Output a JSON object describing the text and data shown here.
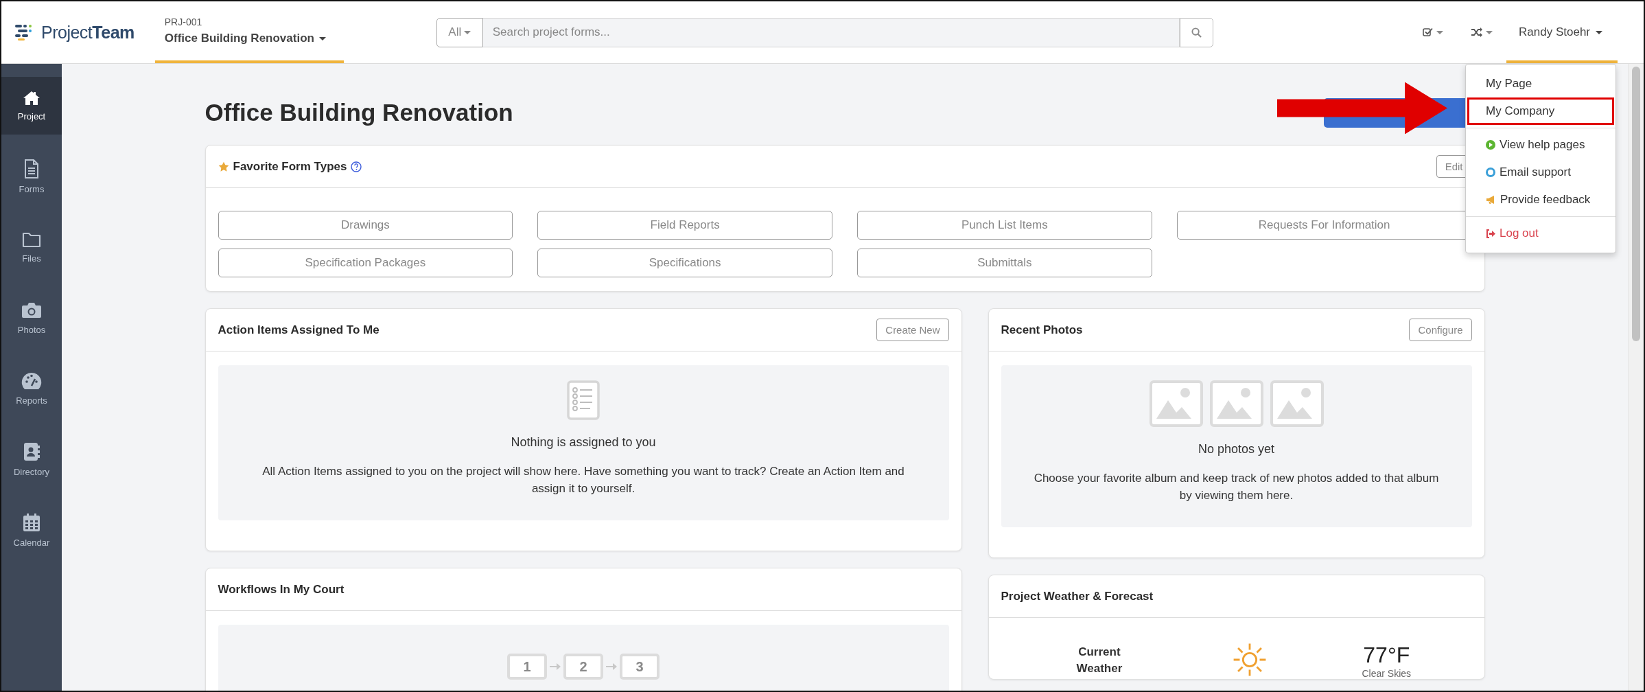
{
  "logo": {
    "light": "Project",
    "bold": "Team"
  },
  "project": {
    "code": "PRJ-001",
    "name": "Office Building Renovation"
  },
  "search": {
    "scope": "All",
    "placeholder": "Search project forms..."
  },
  "user": {
    "name": "Randy Stoehr"
  },
  "user_menu": {
    "groups": [
      {
        "items": [
          {
            "label": "My Page",
            "kind": "plain",
            "highlighted": false
          },
          {
            "label": "My Company",
            "kind": "plain",
            "highlighted": true
          }
        ]
      },
      {
        "items": [
          {
            "label": "View help pages",
            "kind": "help",
            "highlighted": false
          },
          {
            "label": "Email support",
            "kind": "email",
            "highlighted": false
          },
          {
            "label": "Provide feedback",
            "kind": "feedback",
            "highlighted": false
          }
        ]
      },
      {
        "items": [
          {
            "label": "Log out",
            "kind": "logout",
            "highlighted": false
          }
        ]
      }
    ]
  },
  "sidebar": {
    "items": [
      {
        "label": "Project",
        "kind": "home",
        "selected": true
      },
      {
        "label": "Forms",
        "kind": "forms",
        "selected": false
      },
      {
        "label": "Files",
        "kind": "files",
        "selected": false
      },
      {
        "label": "Photos",
        "kind": "photos",
        "selected": false
      },
      {
        "label": "Reports",
        "kind": "reports",
        "selected": false
      },
      {
        "label": "Directory",
        "kind": "directory",
        "selected": false
      },
      {
        "label": "Calendar",
        "kind": "calendar",
        "selected": false
      }
    ]
  },
  "page_title": "Office Building Renovation",
  "favorites": {
    "title": "Favorite Form Types",
    "button": "Edit",
    "form_types": [
      "Drawings",
      "Field Reports",
      "Punch List Items",
      "Requests For Information",
      "Specification Packages",
      "Specifications",
      "Submittals"
    ]
  },
  "action_items": {
    "title": "Action Items Assigned To Me",
    "button": "Create New",
    "empty_title": "Nothing is assigned to you",
    "empty_text": "All Action Items assigned to you on the project will show here. Have something you want to track? Create an Action Item and assign it to yourself."
  },
  "recent_photos": {
    "title": "Recent Photos",
    "button": "Configure",
    "empty_title": "No photos yet",
    "empty_text": "Choose your favorite album and keep track of new photos added to that album by viewing them here."
  },
  "workflows": {
    "title": "Workflows In My Court",
    "steps": [
      "1",
      "2",
      "3"
    ]
  },
  "weather": {
    "title": "Project Weather & Forecast",
    "current_label": "Current Weather",
    "temperature": "77°F",
    "condition": "Clear Skies"
  }
}
